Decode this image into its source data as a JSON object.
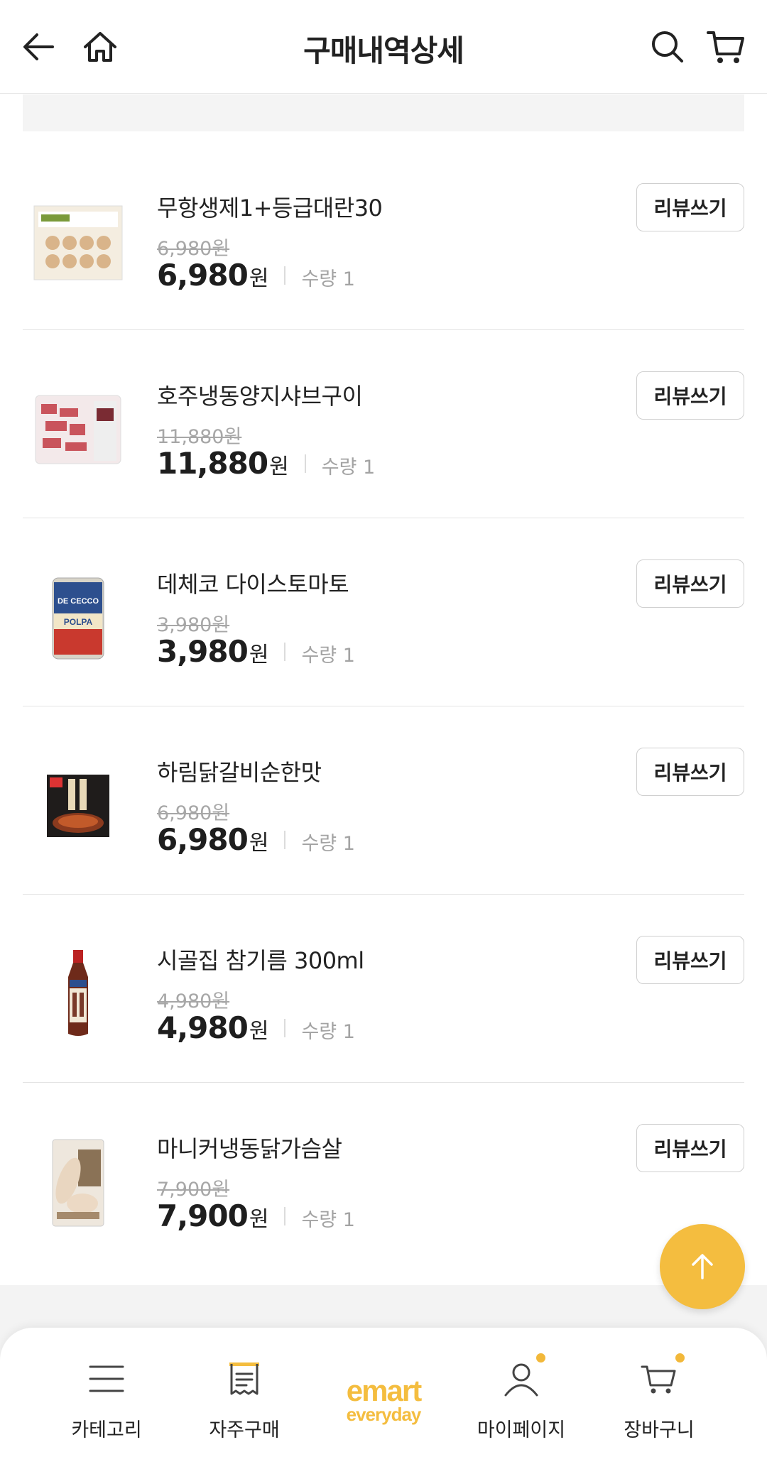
{
  "header": {
    "title": "구매내역상세",
    "back_icon": "back-arrow-icon",
    "home_icon": "home-icon",
    "search_icon": "search-icon",
    "cart_icon": "cart-icon"
  },
  "items": [
    {
      "name": "무항생제1+등급대란30",
      "original_price": "6,980원",
      "price": "6,980",
      "currency": "원",
      "quantity": "수량 1",
      "review_label": "리뷰쓰기"
    },
    {
      "name": "호주냉동양지샤브구이",
      "original_price": "11,880원",
      "price": "11,880",
      "currency": "원",
      "quantity": "수량 1",
      "review_label": "리뷰쓰기"
    },
    {
      "name": "데체코 다이스토마토",
      "original_price": "3,980원",
      "price": "3,980",
      "currency": "원",
      "quantity": "수량 1",
      "review_label": "리뷰쓰기"
    },
    {
      "name": "하림닭갈비순한맛",
      "original_price": "6,980원",
      "price": "6,980",
      "currency": "원",
      "quantity": "수량 1",
      "review_label": "리뷰쓰기"
    },
    {
      "name": "시골집 참기름 300ml",
      "original_price": "4,980원",
      "price": "4,980",
      "currency": "원",
      "quantity": "수량 1",
      "review_label": "리뷰쓰기"
    },
    {
      "name": "마니커냉동닭가슴살",
      "original_price": "7,900원",
      "price": "7,900",
      "currency": "원",
      "quantity": "수량 1",
      "review_label": "리뷰쓰기"
    }
  ],
  "scroll_top_icon": "arrow-up-icon",
  "tabbar": {
    "category": "카테고리",
    "frequent": "자주구매",
    "logo_top": "emart",
    "logo_bottom": "everyday",
    "mypage": "마이페이지",
    "cart": "장바구니"
  },
  "colors": {
    "accent": "#f4bd3f",
    "notification_dot": "#f2b83a"
  }
}
